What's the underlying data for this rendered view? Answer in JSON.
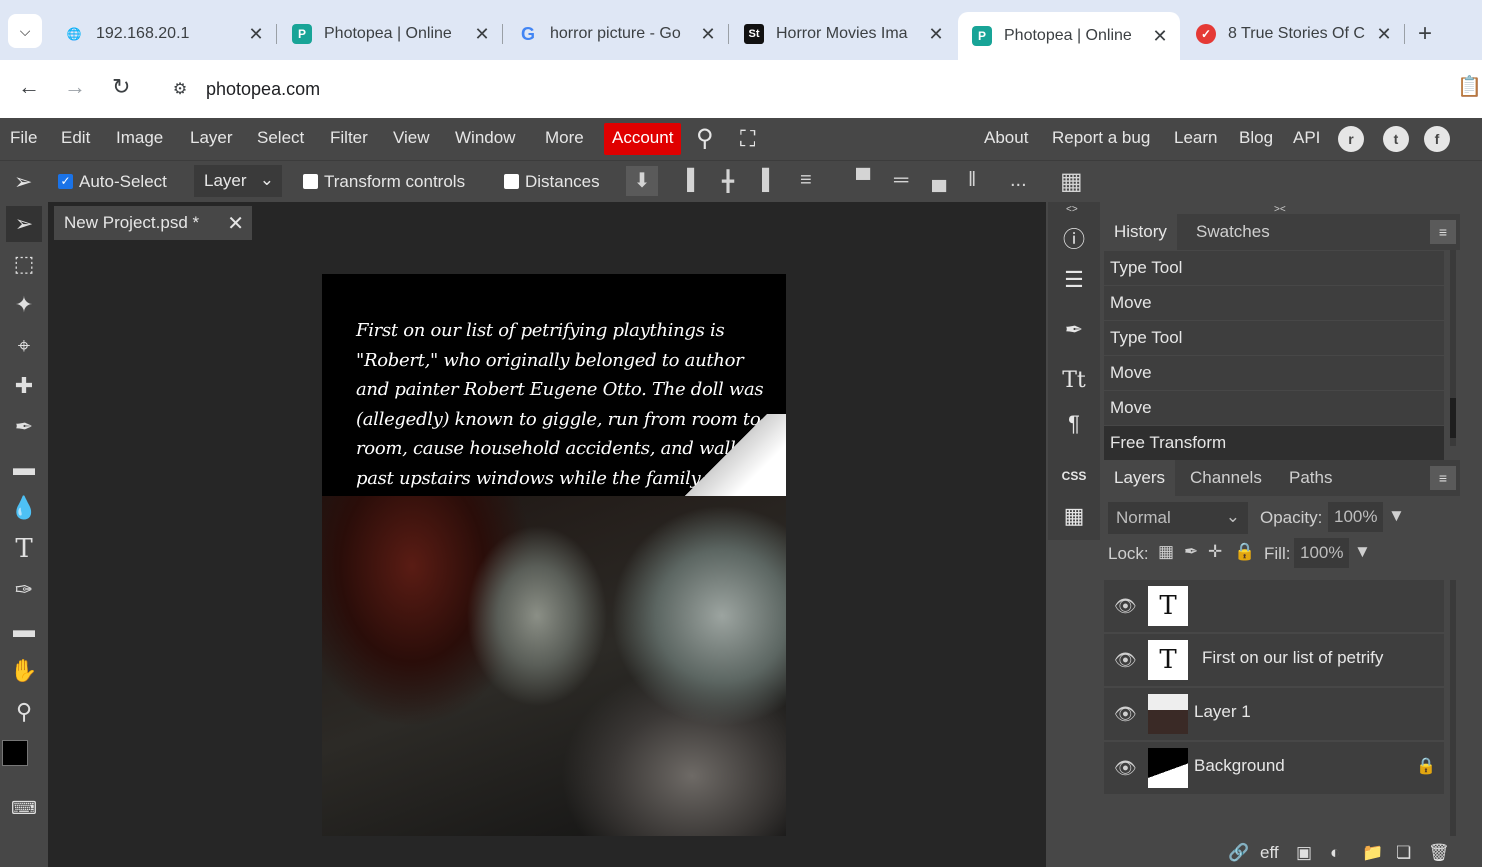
{
  "browser": {
    "tabs": [
      {
        "title": "192.168.20.1",
        "icon": "globe-icon"
      },
      {
        "title": "Photopea | Online",
        "icon": "photopea-icon"
      },
      {
        "title": "horror picture - Go",
        "icon": "google-icon"
      },
      {
        "title": "Horror Movies Ima",
        "icon": "shutterstock-icon"
      },
      {
        "title": "Photopea | Online",
        "icon": "photopea-icon",
        "active": true
      },
      {
        "title": "8 True Stories Of C",
        "icon": "news-icon"
      }
    ],
    "url": "photopea.com"
  },
  "menu": {
    "items": [
      "File",
      "Edit",
      "Image",
      "Layer",
      "Select",
      "Filter",
      "View",
      "Window",
      "More"
    ],
    "account": "Account",
    "right_items": [
      "About",
      "Report a bug",
      "Learn",
      "Blog",
      "API"
    ],
    "account_color": "#e00000"
  },
  "options": {
    "auto_select": "Auto-Select",
    "auto_select_checked": true,
    "layer_select": "Layer",
    "transform_controls": "Transform controls",
    "distances": "Distances",
    "more": "..."
  },
  "document": {
    "tab_title": "New Project.psd *",
    "canvas_text": "First on our list of petrifying playthings is \"Robert,\" who originally belonged to author and painter Robert Eugene Otto. The doll was (allegedly) known to giggle, run from room to room, cause household accidents, and walk past upstairs windows while the family was awa"
  },
  "history": {
    "tab_active": "History",
    "tab_other": "Swatches",
    "items": [
      "Type Tool",
      "Move",
      "Type Tool",
      "Move",
      "Move",
      "Free Transform"
    ]
  },
  "layers_panel": {
    "tabs": [
      "Layers",
      "Channels",
      "Paths"
    ],
    "blend_mode": "Normal",
    "opacity_label": "Opacity:",
    "opacity_value": "100%",
    "lock_label": "Lock:",
    "fill_label": "Fill:",
    "fill_value": "100%",
    "layers": [
      {
        "name": "",
        "type": "text"
      },
      {
        "name": "First on our list of petrify",
        "type": "text"
      },
      {
        "name": "Layer 1",
        "type": "image"
      },
      {
        "name": "Background",
        "type": "background",
        "locked": true
      }
    ],
    "footer_text": "eff"
  },
  "mini_panel": {
    "css_label": "CSS"
  }
}
